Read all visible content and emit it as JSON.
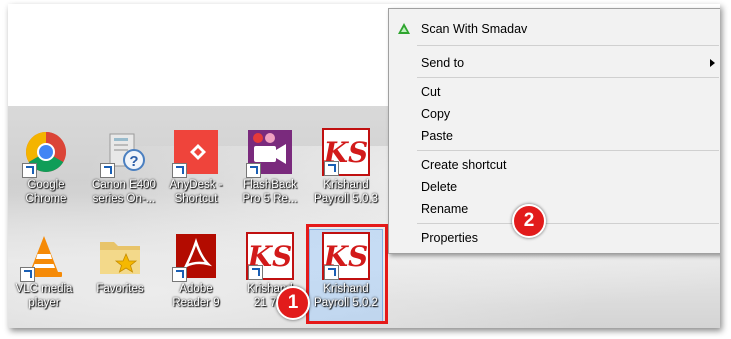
{
  "context_menu": {
    "items": {
      "scan": "Scan With Smadav",
      "send_to": "Send to",
      "cut": "Cut",
      "copy": "Copy",
      "paste": "Paste",
      "create_shortcut": "Create shortcut",
      "delete": "Delete",
      "rename": "Rename",
      "properties": "Properties"
    }
  },
  "desktop": {
    "icons": [
      {
        "label_1": "Google",
        "label_2": "Chrome",
        "icon": "chrome-icon"
      },
      {
        "label_1": "Canon E400",
        "label_2": "series On-...",
        "icon": "canon-help-icon"
      },
      {
        "label_1": "AnyDesk -",
        "label_2": "Shortcut",
        "icon": "anydesk-icon"
      },
      {
        "label_1": "FlashBack",
        "label_2": "Pro 5 Re...",
        "icon": "flashback-icon"
      },
      {
        "label_1": "Krishand",
        "label_2": "Payroll 5.0.3",
        "icon": "krishand-icon",
        "logo": "KS"
      },
      {
        "label_1": "VLC media",
        "label_2": "player",
        "icon": "vlc-icon"
      },
      {
        "label_1": "Favorites",
        "label_2": "",
        "icon": "favorites-folder-icon"
      },
      {
        "label_1": "Adobe",
        "label_2": "Reader 9",
        "icon": "adobe-reader-icon"
      },
      {
        "label_1": "Krishand",
        "label_2": "21 7...",
        "icon": "krishand-icon",
        "logo": "KS"
      },
      {
        "label_1": "Krishand",
        "label_2": "Payroll 5.0.2",
        "icon": "krishand-icon",
        "logo": "KS"
      }
    ]
  },
  "annotations": {
    "step_1": "1",
    "step_2": "2",
    "color": "#e51919"
  }
}
